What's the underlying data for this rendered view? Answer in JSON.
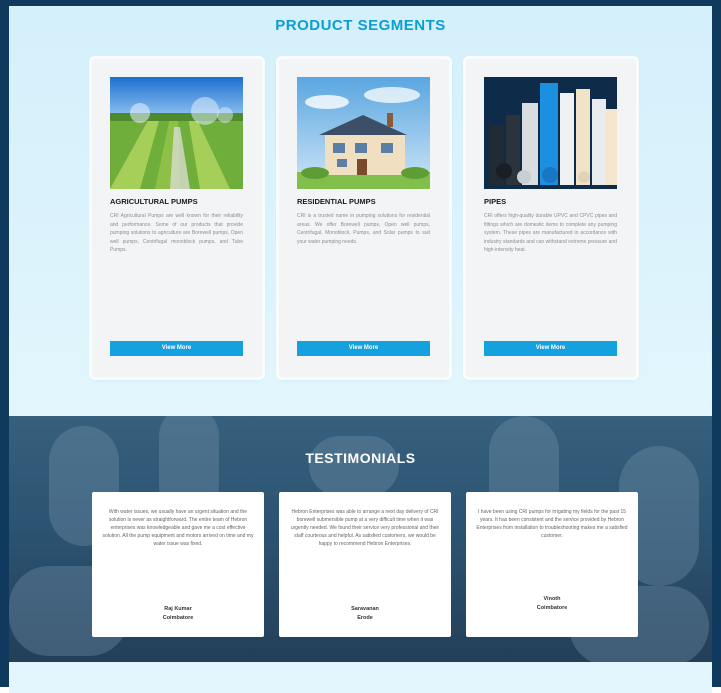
{
  "products": {
    "title": "PRODUCT SEGMENTS",
    "cards": [
      {
        "title": "AGRICULTURAL PUMPS",
        "text": "CRI Agricultural Pumps are well known for their reliability and performance. Some of our products that provide pumping solutions to agriculture are Borewell pumps, Open well pumps, Centrifugal monoblock pumps, and Tube Pumps.",
        "button": "View More"
      },
      {
        "title": "RESIDENTIAL PUMPS",
        "text": "CRI is a trusted name in pumping solutions for residential areas. We offer Borewell pumps, Open well pumps, Centrifugal, Monoblock, Pumps, and Solar pumps to suit your water pumping needs.",
        "button": "View More"
      },
      {
        "title": "PIPES",
        "text": "CRI offers high-quality durable UPVC and CPVC pipes and fittings which are domestic items to complete any pumping system. These pipes are manufactured in accordance with industry standards and can withstand extreme pressure and high-intensity heat.",
        "button": "View More"
      }
    ]
  },
  "testimonials": {
    "title": "TESTIMONIALS",
    "items": [
      {
        "text": "With water issues, we usually have an urgent situation and the solution is never as straightforward. The entire team of Hebron enterprises was knowledgeable and gave me a cost effective solution. All the pump equipment and motors arrived on time and my water issue was fixed.",
        "name": "Raj Kumar",
        "city": "Coimbatore"
      },
      {
        "text": "Hebron Enterprises was able to arrange a next day delivery of CRI borewell submersible pump at a very difficult time when it was urgently needed. We found their service very professional and their staff courteous and helpful. As satisfied customers, we would be happy to recommend Hebron Enterprises.",
        "name": "Saravanan",
        "city": "Erode"
      },
      {
        "text": "I have been using CRI pumps for irrigating my fields for the past 15 years. It has been consistent and the service provided by Hebron Enterprises from installation to troubleshooting makes me a satisfied customer.",
        "name": "Vinoth",
        "city": "Coimbatore"
      }
    ]
  },
  "colors": {
    "accent": "#15a1dd",
    "title_blue": "#0b9ed3",
    "section_bg": "#d4f0fb",
    "frame": "#0f3a5e"
  }
}
